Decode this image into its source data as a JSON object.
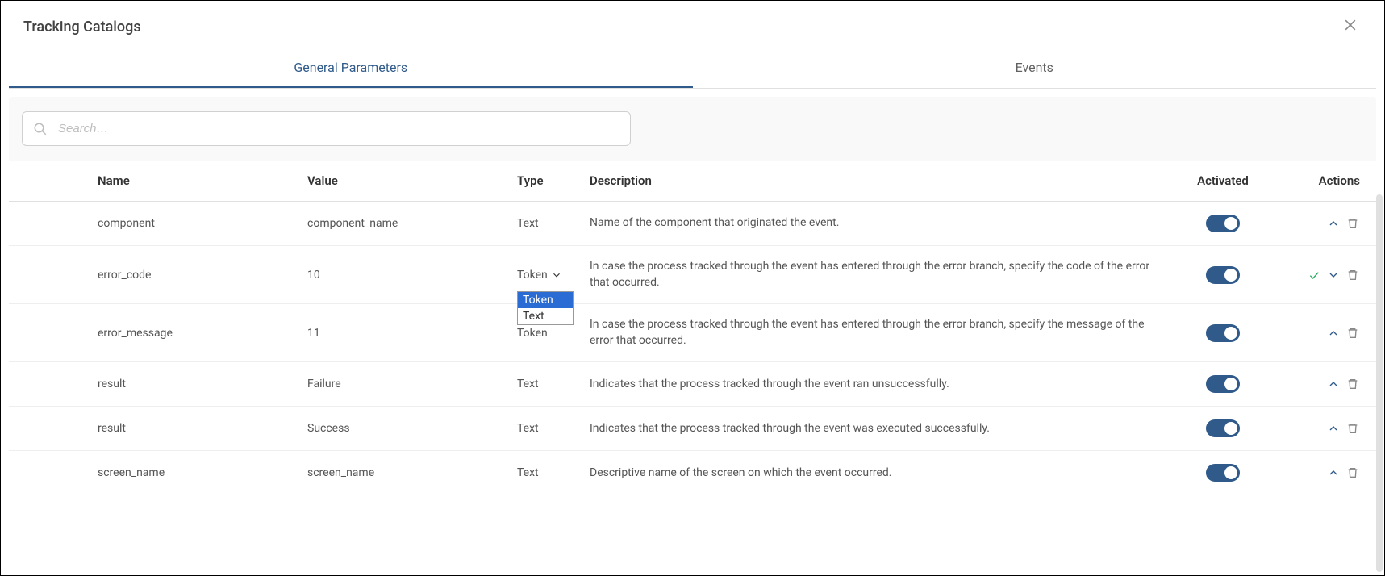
{
  "title": "Tracking Catalogs",
  "tabs": {
    "general": "General Parameters",
    "events": "Events",
    "active": "general"
  },
  "search": {
    "placeholder": "Search…",
    "value": ""
  },
  "table": {
    "headers": {
      "name": "Name",
      "value": "Value",
      "type": "Type",
      "description": "Description",
      "activated": "Activated",
      "actions": "Actions"
    },
    "rows": [
      {
        "name": "component",
        "value": "component_name",
        "type": "Text",
        "description": "Name of the component that originated the event.",
        "activated": true,
        "editing": false,
        "actions": [
          "collapse",
          "delete"
        ]
      },
      {
        "name": "error_code",
        "value": "10",
        "type": "Token",
        "description": "In case the process tracked through the event has entered through the error branch, specify the code of the error that occurred.",
        "activated": true,
        "editing": true,
        "dropdown_open": true,
        "dropdown_options": [
          "Token",
          "Text"
        ],
        "dropdown_selected": "Token",
        "actions": [
          "confirm",
          "expand",
          "delete"
        ]
      },
      {
        "name": "error_message",
        "value": "11",
        "type": "Token",
        "description": "In case the process tracked through the event has entered through the error branch, specify the message of the error that occurred.",
        "activated": true,
        "editing": false,
        "actions": [
          "collapse",
          "delete"
        ]
      },
      {
        "name": "result",
        "value": "Failure",
        "type": "Text",
        "description": "Indicates that the process tracked through the event ran unsuccessfully.",
        "activated": true,
        "editing": false,
        "actions": [
          "collapse",
          "delete"
        ]
      },
      {
        "name": "result",
        "value": "Success",
        "type": "Text",
        "description": "Indicates that the process tracked through the event was executed successfully.",
        "activated": true,
        "editing": false,
        "actions": [
          "collapse",
          "delete"
        ]
      },
      {
        "name": "screen_name",
        "value": "screen_name",
        "type": "Text",
        "description": "Descriptive name of the screen on which the event occurred.",
        "activated": true,
        "editing": false,
        "actions": [
          "collapse",
          "delete"
        ]
      }
    ]
  }
}
